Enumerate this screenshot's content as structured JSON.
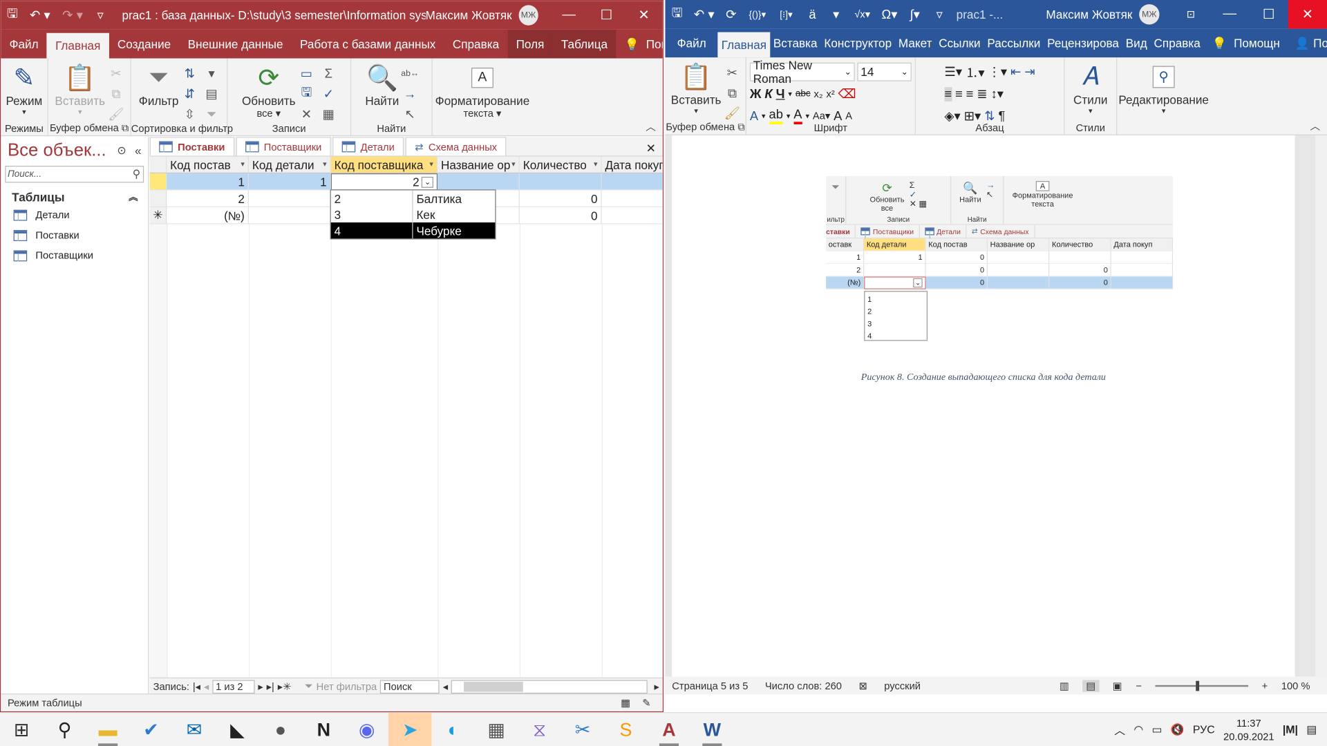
{
  "access": {
    "title": "prac1 : база данных- D:\\study\\3 semester\\Information sys...",
    "user": "Максим Жовтяк",
    "avatar": "МЖ",
    "tabs": [
      "Файл",
      "Главная",
      "Создание",
      "Внешние данные",
      "Работа с базами данных",
      "Справка",
      "Поля",
      "Таблица",
      "Помощн"
    ],
    "active_tab": 1,
    "ribbon": {
      "mode": "Режим",
      "paste": "Вставить",
      "filter": "Фильтр",
      "refresh_line1": "Обновить",
      "refresh_line2": "все",
      "find": "Найти",
      "format_line1": "Форматирование",
      "format_line2": "текста",
      "groups": [
        "Режимы",
        "Буфер обмена",
        "Сортировка и фильтр",
        "Записи",
        "Найти"
      ]
    },
    "nav": {
      "title": "Все объек...",
      "search_placeholder": "Поиск...",
      "section": "Таблицы",
      "items": [
        "Детали",
        "Поставки",
        "Поставщики"
      ]
    },
    "doc_tabs": [
      "Поставки",
      "Поставщики",
      "Детали",
      "Схема данных"
    ],
    "columns": [
      "Код постав",
      "Код детали",
      "Код поставщика",
      "Название ор",
      "Количество",
      "Дата покуп"
    ],
    "rows": [
      [
        "1",
        "1",
        "2",
        "",
        "",
        ""
      ],
      [
        "2",
        "",
        "",
        "",
        "0",
        ""
      ],
      [
        "(№)",
        "",
        "",
        "",
        "0",
        ""
      ]
    ],
    "new_row_marker": "✳",
    "dropdown": [
      {
        "code": "2",
        "name": "Балтика"
      },
      {
        "code": "3",
        "name": "Кек"
      },
      {
        "code": "4",
        "name": "Чебурке"
      }
    ],
    "record_nav": {
      "label": "Запись:",
      "position": "1 из 2",
      "filter": "Нет фильтра",
      "search": "Поиск"
    },
    "status": "Режим таблицы"
  },
  "word": {
    "title": "prac1 -...",
    "user": "Максим Жовтяк",
    "avatar": "МЖ",
    "tabs": [
      "Файл",
      "Главная",
      "Вставка",
      "Конструктор",
      "Макет",
      "Ссылки",
      "Рассылки",
      "Рецензирова",
      "Вид",
      "Справка",
      "Помощн",
      "Поделиться"
    ],
    "active_tab": 1,
    "ribbon": {
      "paste": "Вставить",
      "font": "Times New Roman",
      "size": "14",
      "styles": "Стили",
      "editing": "Редактирование",
      "groups": [
        "Буфер обмена",
        "Шрифт",
        "Абзац",
        "Стили"
      ]
    },
    "picture": {
      "ribbon": {
        "refresh_line1": "Обновить",
        "refresh_line2": "все",
        "find": "Найти",
        "format_line1": "Форматирование",
        "format_line2": "текста",
        "group_records": "Записи",
        "group_find": "Найти",
        "group_filter": "ильтр"
      },
      "tabs": [
        "ставки",
        "Поставщики",
        "Детали",
        "Схема данных"
      ],
      "columns": [
        "оставк",
        "Код детали",
        "Код постав",
        "Название ор",
        "Количество",
        "Дата покуп"
      ],
      "rows": [
        [
          "1",
          "1",
          "0",
          "",
          "",
          ""
        ],
        [
          "2",
          "",
          "0",
          "",
          "0",
          ""
        ],
        [
          "(№)",
          "",
          "0",
          "",
          "0",
          ""
        ]
      ],
      "dropdown": [
        "1",
        "2",
        "3",
        "4"
      ]
    },
    "caption": "Рисунок 8. Создание выпадающего списка для кода детали",
    "status": {
      "page": "Страница 5 из 5",
      "words": "Число слов: 260",
      "lang": "русский",
      "zoom": "100 %"
    }
  },
  "taskbar": {
    "time": "11:37",
    "date": "20.09.2021",
    "lang": "РУС"
  },
  "colors": {
    "access": "#a4373a",
    "word": "#2b579a"
  }
}
